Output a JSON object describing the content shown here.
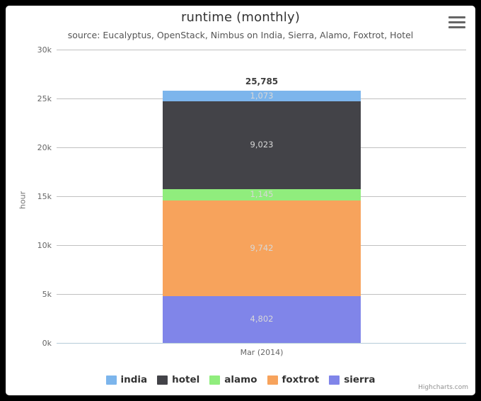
{
  "chart": {
    "title": "runtime (monthly)",
    "subtitle": "source: Eucalyptus, OpenStack, Nimbus on India, Sierra, Alamo, Foxtrot, Hotel",
    "credits": "Highcharts.com",
    "export_menu_icon": "hamburger-menu-icon",
    "background": "#ffffff",
    "page_background": "#000000"
  },
  "chart_data": {
    "type": "bar",
    "stacked": true,
    "orientation": "vertical",
    "title": "runtime (monthly)",
    "subtitle": "source: Eucalyptus, OpenStack, Nimbus on India, Sierra, Alamo, Foxtrot, Hotel",
    "xlabel": "",
    "ylabel": "hour",
    "categories": [
      "Mar (2014)"
    ],
    "ylim": [
      0,
      30000
    ],
    "ytick_labels": [
      "0k",
      "5k",
      "10k",
      "15k",
      "20k",
      "25k",
      "30k"
    ],
    "ytick_values": [
      0,
      5000,
      10000,
      15000,
      20000,
      25000,
      30000
    ],
    "grid": true,
    "legend_position": "bottom",
    "stack_total": 25785,
    "stack_total_label": "25,785",
    "series": [
      {
        "name": "india",
        "values": [
          1073
        ],
        "label": "1,073",
        "color": "#7cb5ec"
      },
      {
        "name": "hotel",
        "values": [
          9023
        ],
        "label": "9,023",
        "color": "#434348"
      },
      {
        "name": "alamo",
        "values": [
          1145
        ],
        "label": "1,145",
        "color": "#90ed7d"
      },
      {
        "name": "foxtrot",
        "values": [
          9742
        ],
        "label": "9,742",
        "color": "#f7a35c"
      },
      {
        "name": "sierra",
        "values": [
          4802
        ],
        "label": "4,802",
        "color": "#8085e9"
      }
    ]
  },
  "yaxis": {
    "title": "hour",
    "ticks": [
      {
        "label": "30k",
        "value": 30000
      },
      {
        "label": "25k",
        "value": 25000
      },
      {
        "label": "20k",
        "value": 20000
      },
      {
        "label": "15k",
        "value": 15000
      },
      {
        "label": "10k",
        "value": 10000
      },
      {
        "label": "5k",
        "value": 5000
      },
      {
        "label": "0k",
        "value": 0
      }
    ]
  },
  "xaxis": {
    "categories": [
      "Mar (2014)"
    ]
  },
  "legend": {
    "items": [
      {
        "label": "india",
        "color": "#7cb5ec"
      },
      {
        "label": "hotel",
        "color": "#434348"
      },
      {
        "label": "alamo",
        "color": "#90ed7d"
      },
      {
        "label": "foxtrot",
        "color": "#f7a35c"
      },
      {
        "label": "sierra",
        "color": "#8085e9"
      }
    ]
  }
}
